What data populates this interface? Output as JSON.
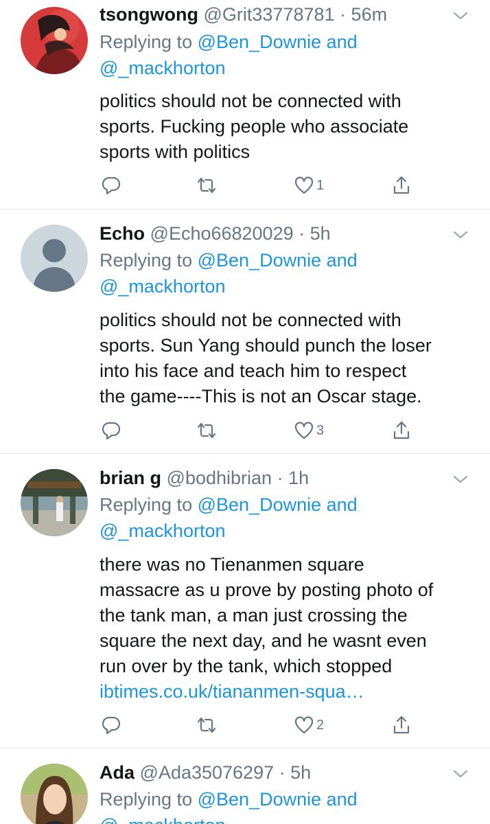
{
  "tweets": [
    {
      "display_name": "tsongwong",
      "handle": "@Grit33778781",
      "separator": "·",
      "time": "56m",
      "reply_prefix": "Replying to",
      "reply_user1": "@Ben_Downie",
      "reply_and": "and",
      "reply_user2": "@_mackhorton",
      "lines": [
        "politics should not be connected with",
        "sports. Fucking people who associate",
        "sports with politics"
      ],
      "link_text": "",
      "reply_count": "",
      "retweet_count": "",
      "like_count": "1"
    },
    {
      "display_name": "Echo",
      "handle": "@Echo66820029",
      "separator": "·",
      "time": "5h",
      "reply_prefix": "Replying to",
      "reply_user1": "@Ben_Downie",
      "reply_and": "and",
      "reply_user2": "@_mackhorton",
      "lines": [
        "politics should not be connected with",
        "sports. Sun Yang should punch the loser",
        "into his face and teach him to respect",
        "the game----This is not an Oscar stage."
      ],
      "link_text": "",
      "reply_count": "",
      "retweet_count": "",
      "like_count": "3"
    },
    {
      "display_name": "brian g",
      "handle": "@bodhibrian",
      "separator": "·",
      "time": "1h",
      "reply_prefix": "Replying to",
      "reply_user1": "@Ben_Downie",
      "reply_and": "and",
      "reply_user2": "@_mackhorton",
      "lines": [
        "there was no Tienanmen square",
        "massacre as u prove by posting photo of",
        "the tank man,  a man just crossing the",
        "square the next day, and he wasnt even",
        "run over by the tank, which stopped"
      ],
      "link_text": "ibtimes.co.uk/tiananmen-squa…",
      "reply_count": "",
      "retweet_count": "",
      "like_count": "2"
    },
    {
      "display_name": "Ada",
      "handle": "@Ada35076297",
      "separator": "·",
      "time": "5h",
      "reply_prefix": "Replying to",
      "reply_user1": "@Ben_Downie",
      "reply_and": "and",
      "reply_user2": "@_mackhorton",
      "lines": [],
      "link_text": "",
      "reply_count": "",
      "retweet_count": "",
      "like_count": ""
    }
  ],
  "icons": {
    "reply": "reply-icon",
    "retweet": "retweet-icon",
    "like": "heart-icon",
    "share": "share-icon",
    "caret": "chevron-down-icon"
  },
  "colors": {
    "link": "#1b95e0",
    "secondary_text": "#657786",
    "primary_text": "#14171a",
    "divider": "#e1e8ed"
  }
}
